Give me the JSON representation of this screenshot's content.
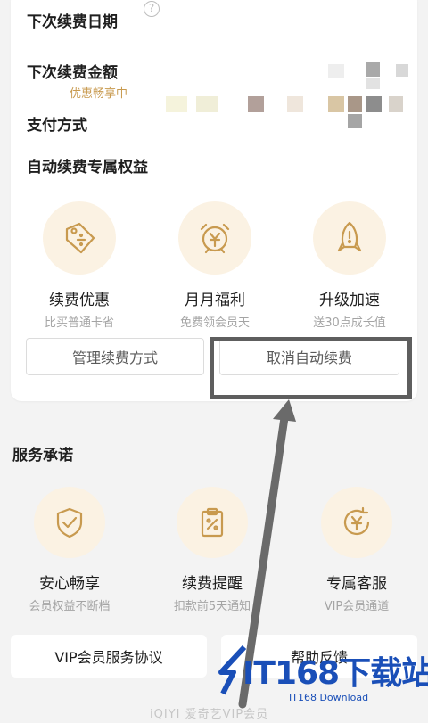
{
  "renewal": {
    "next_date_label": "下次续费日期",
    "help_icon_glyph": "?",
    "next_amount_label": "下次续费金额",
    "promo_text": "优惠畅享中",
    "payment_method_label": "支付方式"
  },
  "benefits": {
    "title": "自动续费专属权益",
    "items": [
      {
        "title": "续费优惠",
        "subtitle": "比买普通卡省",
        "icon": "discount-tag-icon"
      },
      {
        "title": "月月福利",
        "subtitle": "免费领会员天",
        "icon": "alarm-clock-icon"
      },
      {
        "title": "升级加速",
        "subtitle": "送30点成长值",
        "icon": "rocket-icon"
      }
    ]
  },
  "actions": {
    "manage_label": "管理续费方式",
    "cancel_label": "取消自动续费"
  },
  "service": {
    "title": "服务承诺",
    "items": [
      {
        "title": "安心畅享",
        "subtitle": "会员权益不断档",
        "icon": "shield-check-icon"
      },
      {
        "title": "续费提醒",
        "subtitle": "扣款前5天通知",
        "icon": "clipboard-percent-icon"
      },
      {
        "title": "专属客服",
        "subtitle": "VIP会员通道",
        "icon": "refresh-yen-icon"
      }
    ]
  },
  "bottom": {
    "agreement_label": "VIP会员服务协议",
    "feedback_label": "帮助反馈"
  },
  "footer": {
    "brand": "iQIYI 爱奇艺VIP会员"
  },
  "watermark": {
    "main": "IT168下载站",
    "sub": "IT168 Download"
  },
  "colors": {
    "accent_gold": "#c89a4f",
    "icon_bg": "#fbf2e3",
    "annotation": "#5e5e5e",
    "watermark_blue": "#1a4fb8"
  }
}
